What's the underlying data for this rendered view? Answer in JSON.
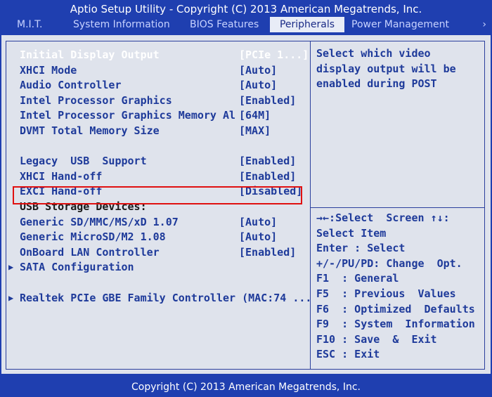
{
  "title": "Aptio Setup Utility - Copyright (C) 2013 American Megatrends, Inc.",
  "tabs": [
    {
      "label": "M.I.T."
    },
    {
      "label": "System Information"
    },
    {
      "label": "BIOS Features"
    },
    {
      "label": "Peripherals",
      "active": true
    },
    {
      "label": "Power Management"
    }
  ],
  "tab_scroll_glyph": "›",
  "settings": [
    {
      "label": "Initial Display Output",
      "value": "[PCIe 1...]"
    },
    {
      "label": "XHCI Mode",
      "value": "[Auto]"
    },
    {
      "label": "Audio Controller",
      "value": "[Auto]"
    },
    {
      "label": "Intel Processor Graphics",
      "value": "[Enabled]"
    },
    {
      "label": "Intel Processor Graphics Memory Al",
      "value": "[64M]"
    },
    {
      "label": "DVMT Total Memory Size",
      "value": "[MAX]"
    },
    {
      "label": "Legacy  USB  Support",
      "value": "[Enabled]"
    },
    {
      "label": "XHCI Hand-off",
      "value": "[Enabled]"
    },
    {
      "label": "EXCI Hand-off",
      "value": "[Disabled]"
    },
    {
      "label": "USB Storage Devices:"
    },
    {
      "label": "Generic SD/MMC/MS/xD 1.07",
      "value": "[Auto]"
    },
    {
      "label": "Generic MicroSD/M2 1.08",
      "value": "[Auto]"
    },
    {
      "label": "OnBoard LAN Controller",
      "value": "[Enabled]"
    },
    {
      "label": "SATA Configuration"
    },
    {
      "label": "Realtek PCIe GBE Family Controller (MAC:74 ..."
    }
  ],
  "help_text": "Select which video\ndisplay output will be\nenabled during POST",
  "keys": [
    "→←:Select  Screen ↑↓:",
    "Select Item",
    "Enter : Select",
    "+/-/PU/PD: Change  Opt.",
    "F1  : General",
    "F5  : Previous  Values",
    "F6  : Optimized  Defaults",
    "F9  : System  Information",
    "F10 : Save  &  Exit",
    "ESC : Exit"
  ],
  "footer": "Copyright (C) 2013 American Megatrends, Inc.",
  "colors": {
    "background": "#1f3fb0",
    "panel": "#dfe3ec",
    "item_text": "#1e3a9a",
    "highlight_box": "#e01010"
  }
}
